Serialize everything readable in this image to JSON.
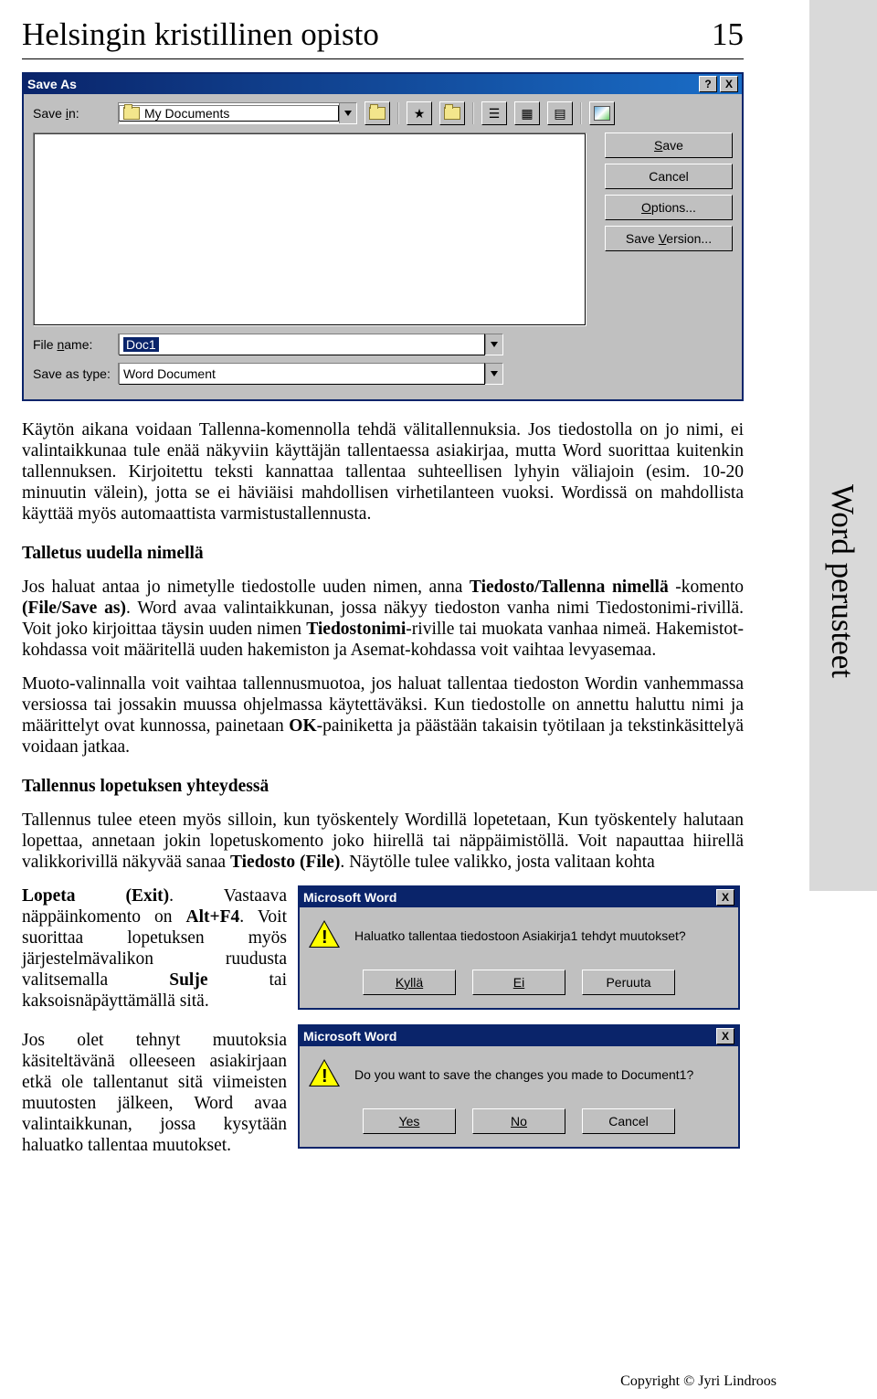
{
  "header": {
    "title": "Helsingin kristillinen opisto",
    "page_number": "15"
  },
  "side_title": "Word perusteet",
  "save_as": {
    "title": "Save As",
    "help": "?",
    "close": "X",
    "save_in_label": "Save in:",
    "folder_name": "My Documents",
    "file_name_label": "File name:",
    "file_name_value": "Doc1",
    "type_label": "Save as type:",
    "type_value": "Word Document",
    "btn_save": "Save",
    "btn_cancel": "Cancel",
    "btn_options": "Options...",
    "btn_version": "Save Version...",
    "btn_save_underline": "S",
    "btn_options_underline": "O",
    "btn_version_underline": "V",
    "file_name_underline": "n",
    "save_in_underline": "i"
  },
  "body": {
    "p1": "Käytön aikana voidaan Tallenna-komennolla tehdä välitallennuksia. Jos tiedostolla on jo nimi, ei valintaikkunaa tule enää näkyviin käyttäjän tallentaessa asiakirjaa, mutta Word suorittaa kuitenkin tallennuksen. Kirjoitettu teksti kannattaa tallentaa suhteellisen lyhyin väliajoin (esim. 10-20 minuutin välein), jotta se ei häviäisi mahdollisen virhetilanteen vuoksi. Wordissä on mahdollista käyttää myös automaattista varmistustallennusta.",
    "h1": "Talletus uudella nimellä",
    "p2a": "Jos haluat antaa jo nimetylle tiedostolle uuden nimen, anna ",
    "p2b": "Tiedosto/Tallenna nimellä",
    "p2c": " -komento ",
    "p2d": "(File/Save as)",
    "p2e": ". Word avaa valintaikkunan, jossa näkyy tiedoston vanha nimi Tiedostonimi-rivillä. Voit joko kirjoittaa täysin uuden nimen ",
    "p2f": "Tiedostonimi",
    "p2g": "-riville tai muokata vanhaa nimeä. Hakemistot-kohdassa voit määritellä uuden hakemiston ja Asemat-kohdassa voit vaihtaa levyasemaa.",
    "p3a": "Muoto-valinnalla voit vaihtaa tallennusmuotoa, jos haluat tallentaa tiedoston Wordin vanhemmassa versiossa tai jossakin muussa ohjelmassa käytettäväksi. Kun tiedostolle on annettu haluttu nimi ja määrittelyt ovat kunnossa, painetaan ",
    "p3b": "OK",
    "p3c": "-painiketta ja päästään takaisin työtilaan ja tekstinkäsittelyä voidaan jatkaa.",
    "h2": "Tallennus lopetuksen yhteydessä",
    "p4a": "Tallennus tulee eteen myös silloin, kun työskentely Wordillä lopetetaan, Kun työskentely halutaan lopettaa, annetaan jokin lopetuskomento joko hiirellä tai näppäimistöllä. Voit napauttaa hiirellä valikkorivillä näkyvää sanaa ",
    "p4b": "Tiedosto (File)",
    "p4c": ". Näytölle tulee valikko, josta valitaan kohta ",
    "p5a": "Lopeta (Exit)",
    "p5b": ". Vastaava näppäinkomento on ",
    "p5c": "Alt+F4",
    "p5d": ". Voit suorittaa lopetuksen myös järjestelmävalikon ruudusta valitsemalla ",
    "p5e": "Sulje",
    "p5f": " tai kaksoisnäpäyttämällä sitä.",
    "p6": "Jos olet tehnyt muutoksia käsiteltävänä olleeseen asiakirjaan etkä ole tallentanut sitä viimeisten muutosten jälkeen, Word avaa valintaikkunan, jossa kysytään haluatko tallentaa muutokset."
  },
  "mb1": {
    "title": "Microsoft Word",
    "msg": "Haluatko tallentaa tiedostoon Asiakirja1 tehdyt muutokset?",
    "yes": "Kyllä",
    "no": "Ei",
    "cancel": "Peruuta"
  },
  "mb2": {
    "title": "Microsoft Word",
    "msg": "Do you want to save the changes you made to Document1?",
    "yes": "Yes",
    "no": "No",
    "cancel": "Cancel"
  },
  "copyright": "Copyright © Jyri Lindroos"
}
